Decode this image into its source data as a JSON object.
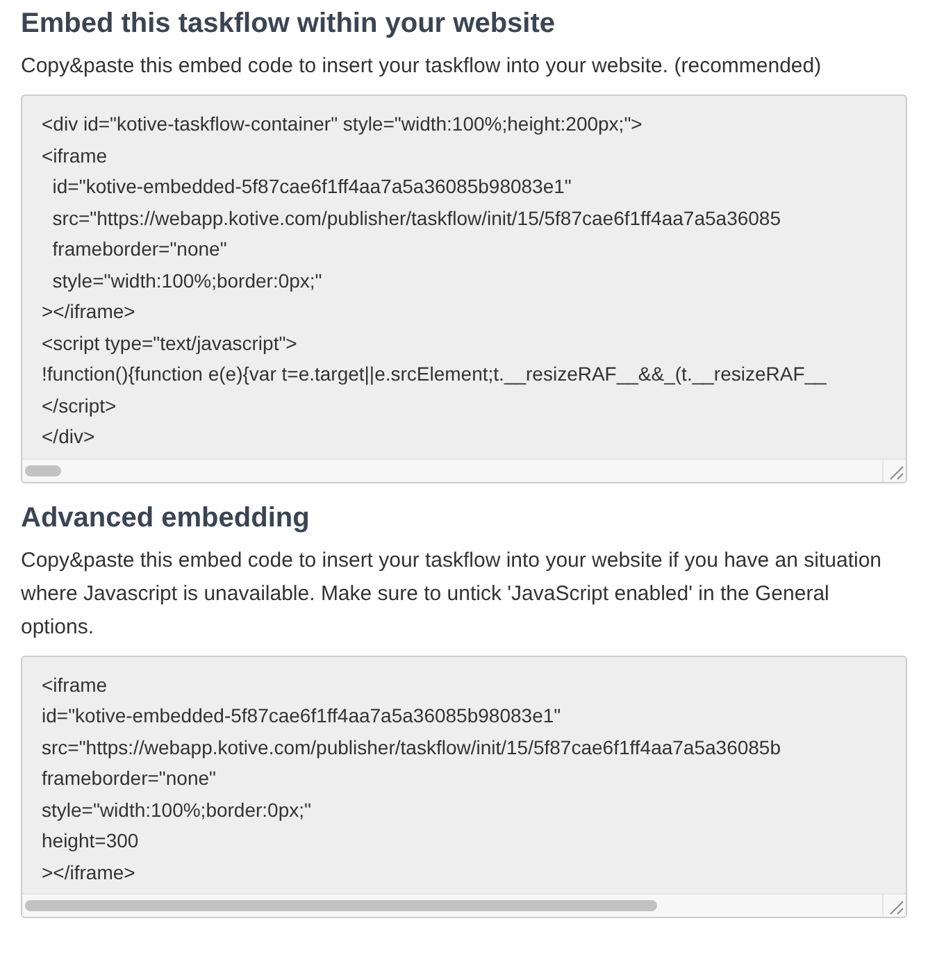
{
  "sections": [
    {
      "heading": "Embed this taskflow within your website",
      "description": "Copy&paste this embed code to insert your taskflow into your website. (recommended)",
      "code_lines": [
        "<div id=\"kotive-taskflow-container\" style=\"width:100%;height:200px;\">",
        "<iframe",
        "  id=\"kotive-embedded-5f87cae6f1ff4aa7a5a36085b98083e1\"",
        "  src=\"https://webapp.kotive.com/publisher/taskflow/init/15/5f87cae6f1ff4aa7a5a36085",
        "  frameborder=\"none\"",
        "  style=\"width:100%;border:0px;\"",
        "></iframe>",
        "<script type=\"text/javascript\">",
        "!function(){function e(e){var t=e.target||e.srcElement;t.__resizeRAF__&&_(t.__resizeRAF__",
        "</script>",
        "</div>"
      ]
    },
    {
      "heading": "Advanced embedding",
      "description": "Copy&paste this embed code to insert your taskflow into your website if you have an situation where Javascript is unavailable. Make sure to untick 'JavaScript enabled' in the General options.",
      "code_lines": [
        "<iframe",
        "id=\"kotive-embedded-5f87cae6f1ff4aa7a5a36085b98083e1\"",
        "src=\"https://webapp.kotive.com/publisher/taskflow/init/15/5f87cae6f1ff4aa7a5a36085b",
        "frameborder=\"none\"",
        "style=\"width:100%;border:0px;\"",
        "height=300",
        "></iframe>"
      ]
    }
  ]
}
